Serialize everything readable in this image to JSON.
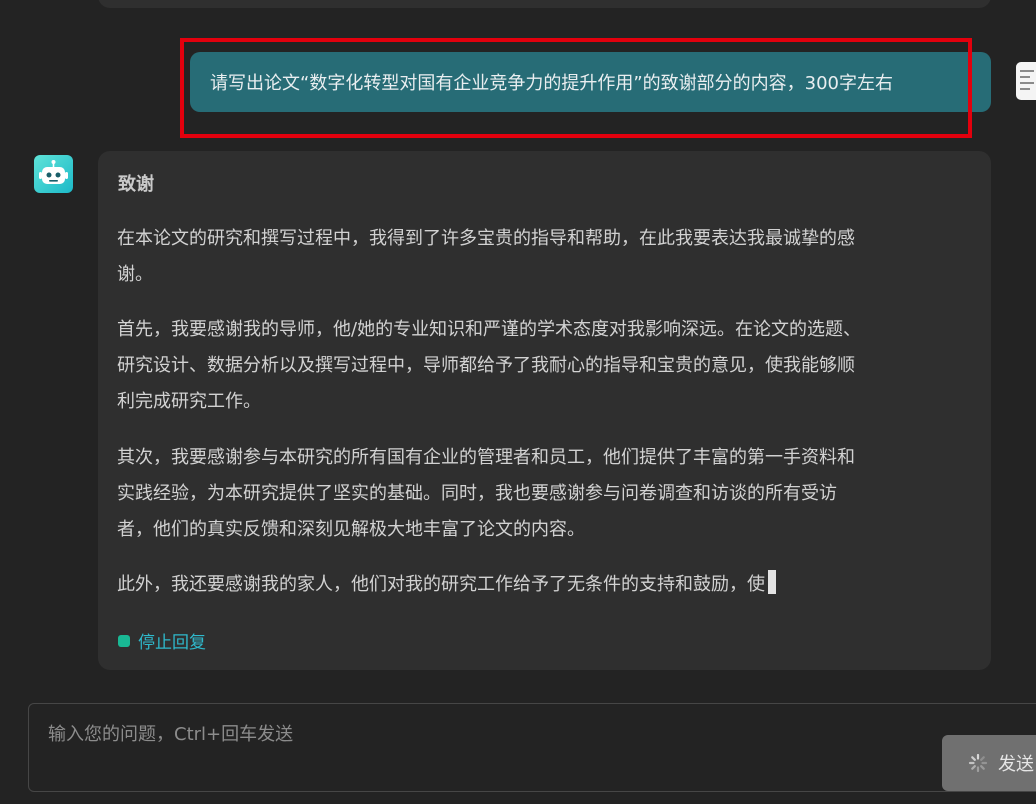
{
  "user_message": {
    "text": "请写出论文“数字化转型对国有企业竞争力的提升作用”的致谢部分的内容，300字左右"
  },
  "bot_response": {
    "title": "致谢",
    "paragraphs": [
      [
        "在本论文的研究和撰写过程中，我得到了许多宝贵的指导和帮助，在此我要表达我最诚挚的感",
        "谢。"
      ],
      [
        "首先，我要感谢我的导师，他/她的专业知识和严谨的学术态度对我影响深远。在论文的选题、",
        "研究设计、数据分析以及撰写过程中，导师都给予了我耐心的指导和宝贵的意见，使我能够顺",
        "利完成研究工作。"
      ],
      [
        "其次，我要感谢参与本研究的所有国有企业的管理者和员工，他们提供了丰富的第一手资料和",
        "实践经验，为本研究提供了坚实的基础。同时，我也要感谢参与问卷调查和访谈的所有受访",
        "者，他们的真实反馈和深刻见解极大地丰富了论文的内容。"
      ],
      [
        "此外，我还要感谢我的家人，他们对我的研究工作给予了无条件的支持和鼓励，使"
      ]
    ],
    "stop_label": "停止回复"
  },
  "input": {
    "placeholder": "输入您的问题，Ctrl+回车发送",
    "value": ""
  },
  "send_button": {
    "label": "发送",
    "icon": "loading-spinner-icon"
  },
  "colors": {
    "background": "#232323",
    "card": "#2f2f2f",
    "user_bubble": "#276c76",
    "highlight_border": "#e3000d",
    "bot_avatar_gradient": [
      "#5fe3d8",
      "#1cb9c8"
    ],
    "stop_dot": "#19b894",
    "stop_text": "#2fb9cc",
    "send_button": "#707070"
  }
}
